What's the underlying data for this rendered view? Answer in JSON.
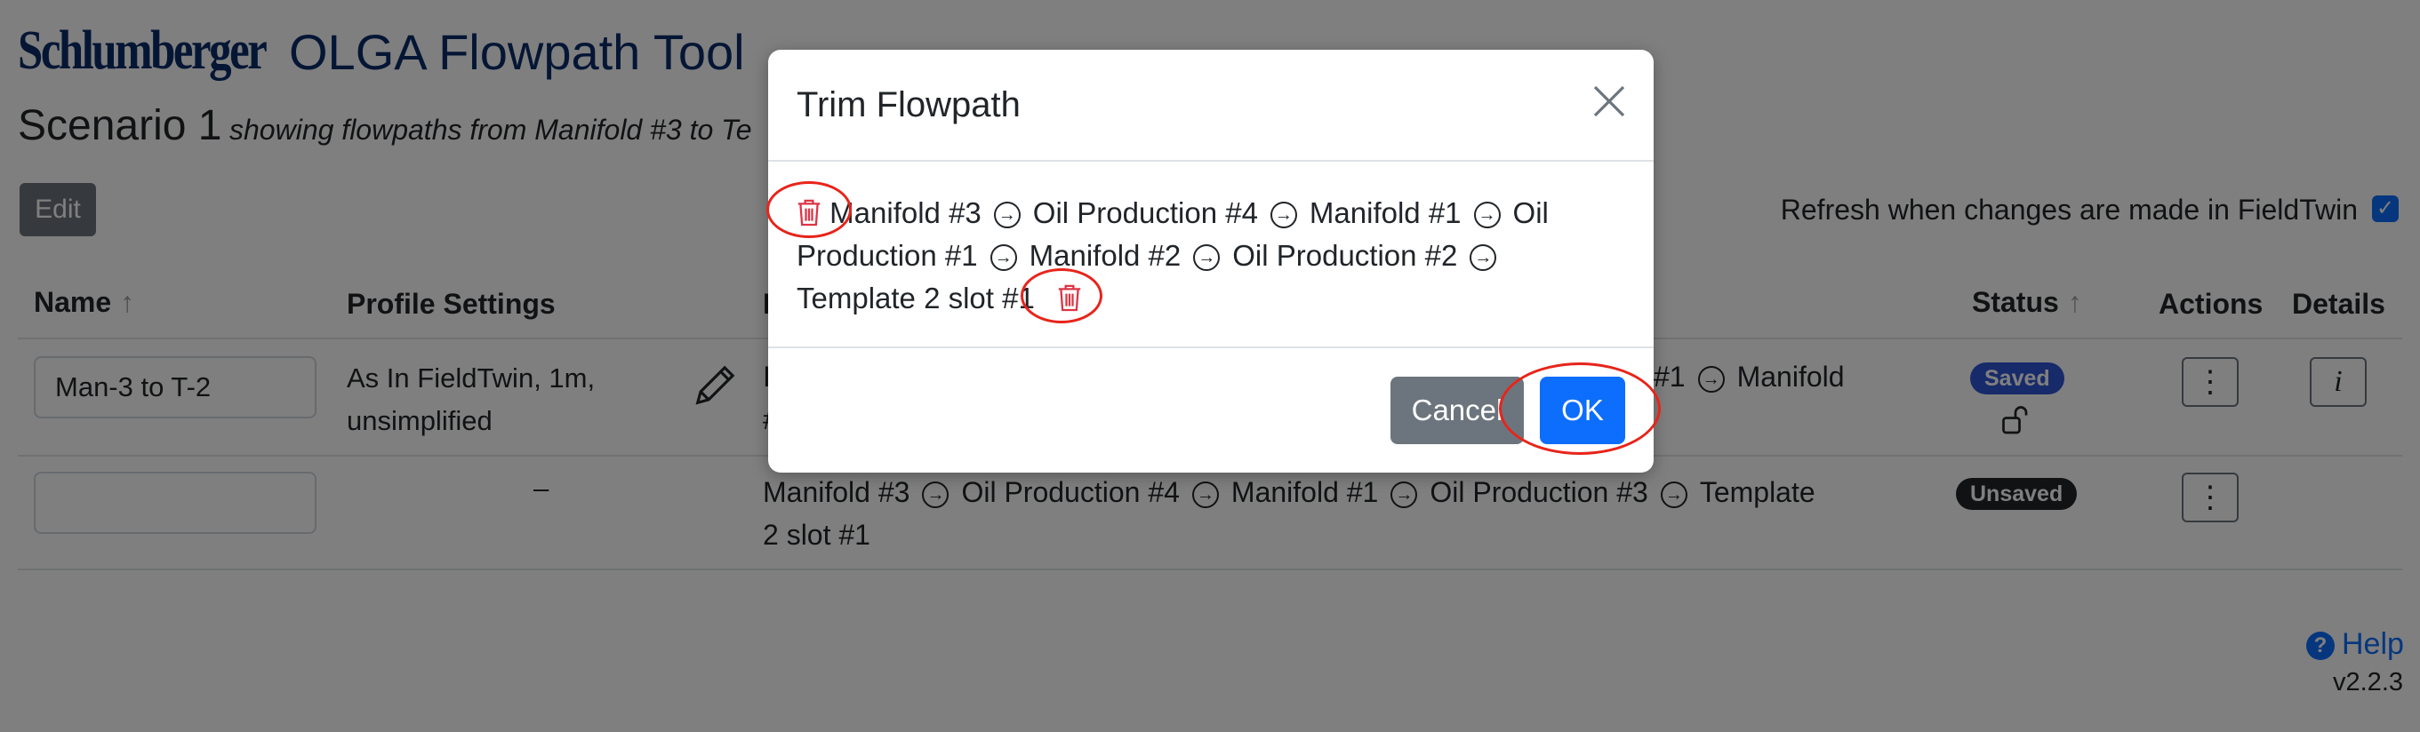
{
  "header": {
    "brand": "Schlumberger",
    "app_title": "OLGA Flowpath Tool",
    "scenario": "Scenario 1",
    "scenario_subtitle": "showing flowpaths from Manifold #3 to Te"
  },
  "toolbar": {
    "edit_label": "Edit",
    "refresh_label": "Refresh when changes are made in FieldTwin",
    "refresh_checked": true
  },
  "table": {
    "headers": {
      "name": "Name",
      "profile": "Profile Settings",
      "path": "F",
      "status": "Status",
      "actions": "Actions",
      "details": "Details"
    },
    "rows": [
      {
        "name": "Man-3 to T-2",
        "profile": "As In FieldTwin, 1m, unsimplified",
        "path_partial_left": "I",
        "path_partial_left2": "#",
        "path_partial_right": "#1",
        "path_partial_right2": "Manifold",
        "status": "Saved",
        "status_color": "#2f55d4",
        "details_label": "i"
      },
      {
        "name": "",
        "profile": "–",
        "path_line1": [
          "Manifold #3",
          "Oil Production #4",
          "Manifold #1",
          "Oil Production #3",
          "Template"
        ],
        "path_line2": "2 slot #1",
        "status": "Unsaved",
        "status_color": "#212529"
      }
    ]
  },
  "footer": {
    "help_label": "Help",
    "version": "v2.2.3"
  },
  "modal": {
    "title": "Trim Flowpath",
    "path": [
      "Manifold #3",
      "Oil Production #4",
      "Manifold #1",
      "Oil Production #1",
      "Manifold #2",
      "Oil Production #2",
      "Template 2 slot #1"
    ],
    "path_first_line_tail": "Oil",
    "path_second_line_head": "Production #1",
    "cancel_label": "Cancel",
    "ok_label": "OK"
  },
  "colors": {
    "brand": "#0b2c6b",
    "primary": "#0d6efd",
    "secondary": "#6c757d",
    "danger": "#dc3545",
    "annotation": "#e8241a"
  }
}
